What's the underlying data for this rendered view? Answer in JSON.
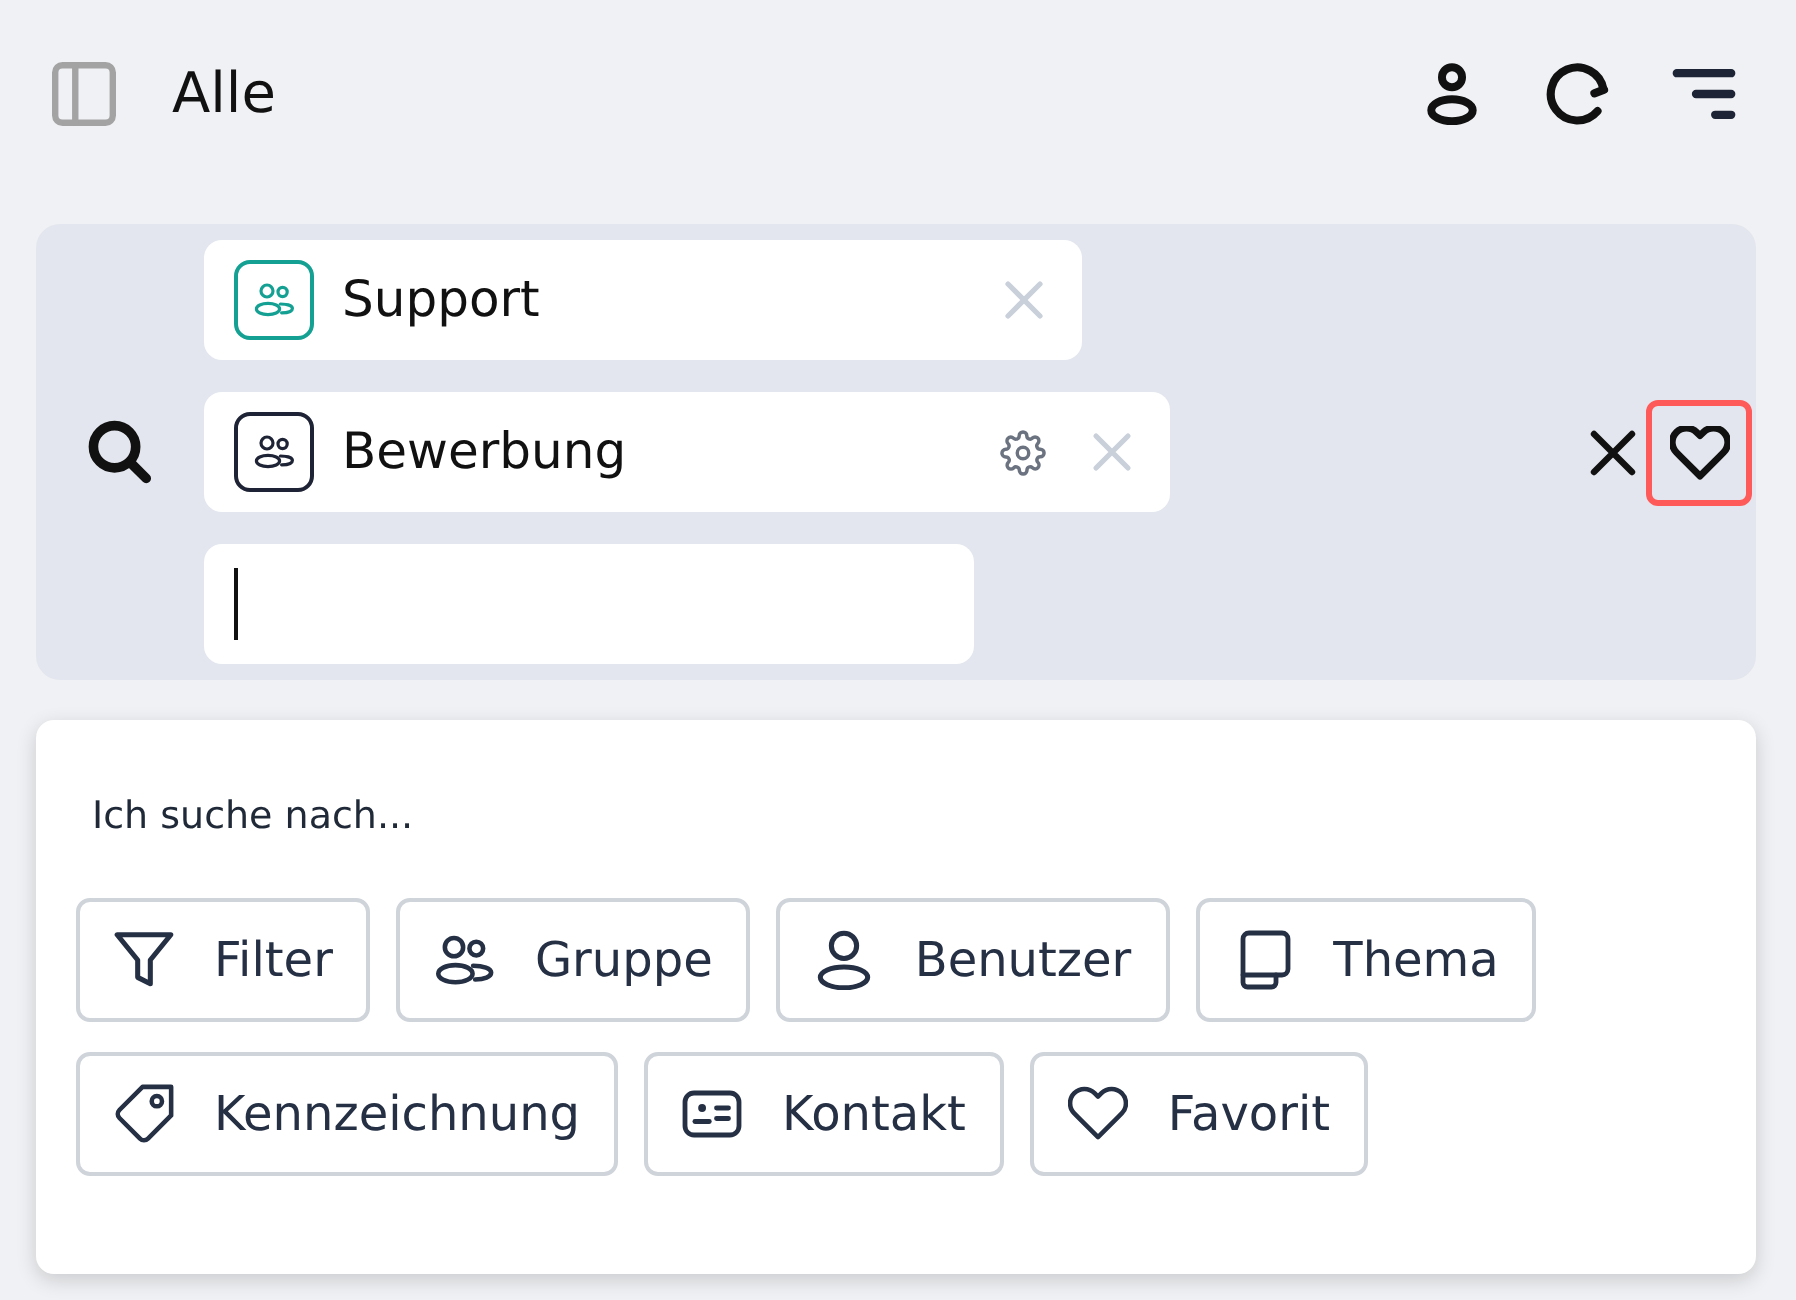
{
  "header": {
    "title": "Alle"
  },
  "search": {
    "chips": [
      {
        "label": "Support",
        "color": "#14a093",
        "configurable": false
      },
      {
        "label": "Bewerbung",
        "color": "#1e2435",
        "configurable": true
      }
    ],
    "input": {
      "focused": true
    },
    "favorite_button": {
      "focused": true
    }
  },
  "suggestions": {
    "heading": "Ich suche nach...",
    "options": [
      {
        "label": "Filter",
        "kind": "filter"
      },
      {
        "label": "Gruppe",
        "kind": "group"
      },
      {
        "label": "Benutzer",
        "kind": "user"
      },
      {
        "label": "Thema",
        "kind": "topic"
      },
      {
        "label": "Kennzeichnung",
        "kind": "tag"
      },
      {
        "label": "Kontakt",
        "kind": "contact"
      },
      {
        "label": "Favorit",
        "kind": "favorite"
      }
    ]
  }
}
